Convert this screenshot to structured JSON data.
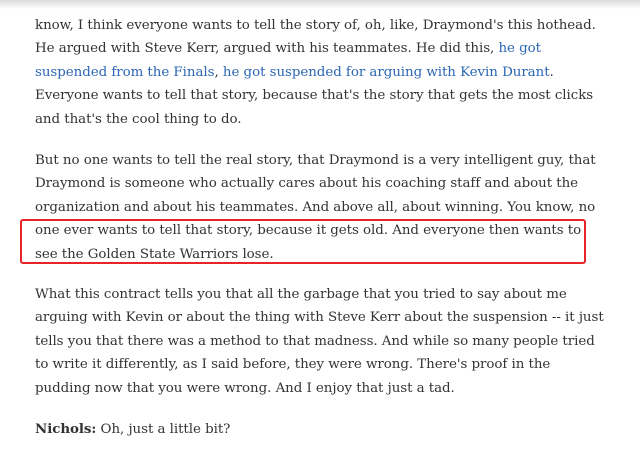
{
  "article": {
    "p1": {
      "text_a": "know, I think everyone wants to tell the story of, oh, like, Draymond's this hothead. He argued with Steve Kerr, argued with his teammates. He did this, ",
      "link1": "he got suspended from the Finals",
      "sep": ", ",
      "link2": "he got suspended for arguing with Kevin Durant",
      "text_b": ". Everyone wants to tell that story, because that's the story that gets the most clicks and that's the cool thing to do."
    },
    "p2": {
      "text": "But no one wants to tell the real story, that Draymond is a very intelligent guy, that Draymond is someone who actually cares about his coaching staff and about the organization and about his teammates. And above all, about winning. You know, no one ever wants to tell that story, because it gets old. And everyone then wants to see the Golden State Warriors lose."
    },
    "p3": {
      "text": "What this contract tells you that all the garbage that you tried to say about me arguing with Kevin or about the thing with Steve Kerr about the suspension -- it just tells you that there was a method to that madness. And while so many people tried to write it differently, as I said before, they were wrong. There's proof in the pudding now that you were wrong. And I enjoy that just a tad."
    },
    "p4": {
      "speaker": "Nichols:",
      "text": " Oh, just a little bit?"
    }
  },
  "colors": {
    "link": "#2b66b5",
    "highlight_border": "#e8242a",
    "body_text": "#333333"
  }
}
